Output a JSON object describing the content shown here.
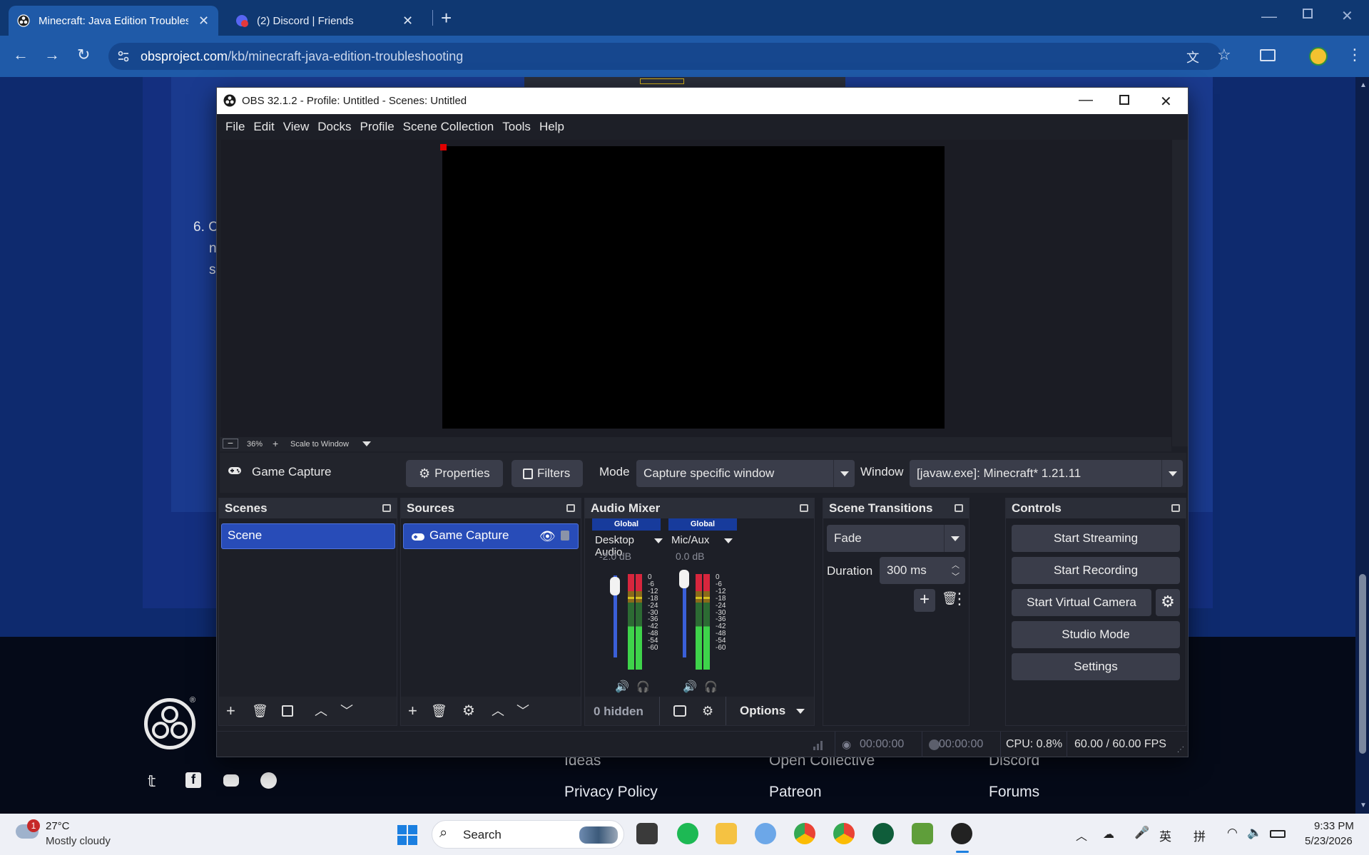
{
  "browser": {
    "tabs": [
      {
        "title": "Minecraft: Java Edition Troubles",
        "active": true
      },
      {
        "title": "(2) Discord | Friends",
        "active": false
      }
    ],
    "discord_badge": "2",
    "url_host": "obsproject.com",
    "url_path": "/kb/minecraft-java-edition-troubleshooting"
  },
  "page": {
    "step_number": "6. C",
    "step_line2": "n",
    "step_line3": "s",
    "footer_links": [
      "Ideas",
      "Privacy Policy",
      "Open Collective",
      "Patreon",
      "Discord",
      "Forums"
    ],
    "trademark": "®"
  },
  "obs": {
    "title": "OBS 32.1.2 - Profile: Untitled - Scenes: Untitled",
    "menu": [
      "File",
      "Edit",
      "View",
      "Docks",
      "Profile",
      "Scene Collection",
      "Tools",
      "Help"
    ],
    "zoom": "36%",
    "scale_mode": "Scale to Window",
    "source_bar": {
      "source_name": "Game Capture",
      "properties": "Properties",
      "filters": "Filters",
      "mode_label": "Mode",
      "mode_value": "Capture specific window",
      "window_label": "Window",
      "window_value": "[javaw.exe]: Minecraft* 1.21.11"
    },
    "scenes": {
      "title": "Scenes",
      "items": [
        "Scene"
      ]
    },
    "sources": {
      "title": "Sources",
      "items": [
        "Game Capture"
      ]
    },
    "mixer": {
      "title": "Audio Mixer",
      "channels": [
        {
          "tag": "Global",
          "name": "Desktop Audio",
          "db": "-2.0 dB",
          "level": 0.9
        },
        {
          "tag": "Global",
          "name": "Mic/Aux",
          "db": "0.0 dB",
          "level": 1.0
        }
      ],
      "scale": [
        "0",
        "-6",
        "-12",
        "-18",
        "-24",
        "-30",
        "-36",
        "-42",
        "-48",
        "-54",
        "-60"
      ],
      "hidden": "0 hidden",
      "options": "Options"
    },
    "transitions": {
      "title": "Scene Transitions",
      "type": "Fade",
      "duration_label": "Duration",
      "duration_value": "300 ms"
    },
    "controls": {
      "title": "Controls",
      "start_streaming": "Start Streaming",
      "start_recording": "Start Recording",
      "start_virtual_camera": "Start Virtual Camera",
      "studio_mode": "Studio Mode",
      "settings": "Settings"
    },
    "status": {
      "stream_time": "00:00:00",
      "rec_time": "00:00:00",
      "cpu": "CPU: 0.8%",
      "fps": "60.00 / 60.00 FPS"
    }
  },
  "taskbar": {
    "weather_badge": "1",
    "temperature": "27°C",
    "weather": "Mostly cloudy",
    "search": "Search",
    "ime1": "英",
    "ime2": "拼",
    "time": "9:33 PM",
    "date": "5/23/2026"
  },
  "colors": {
    "accent": "#284cb8",
    "browser_tab": "#1f5aa8",
    "obs_bg": "#1d1f27",
    "meter_green": "#3ed34a",
    "meter_yellow": "#d6c21e",
    "meter_red": "#d7263d"
  }
}
